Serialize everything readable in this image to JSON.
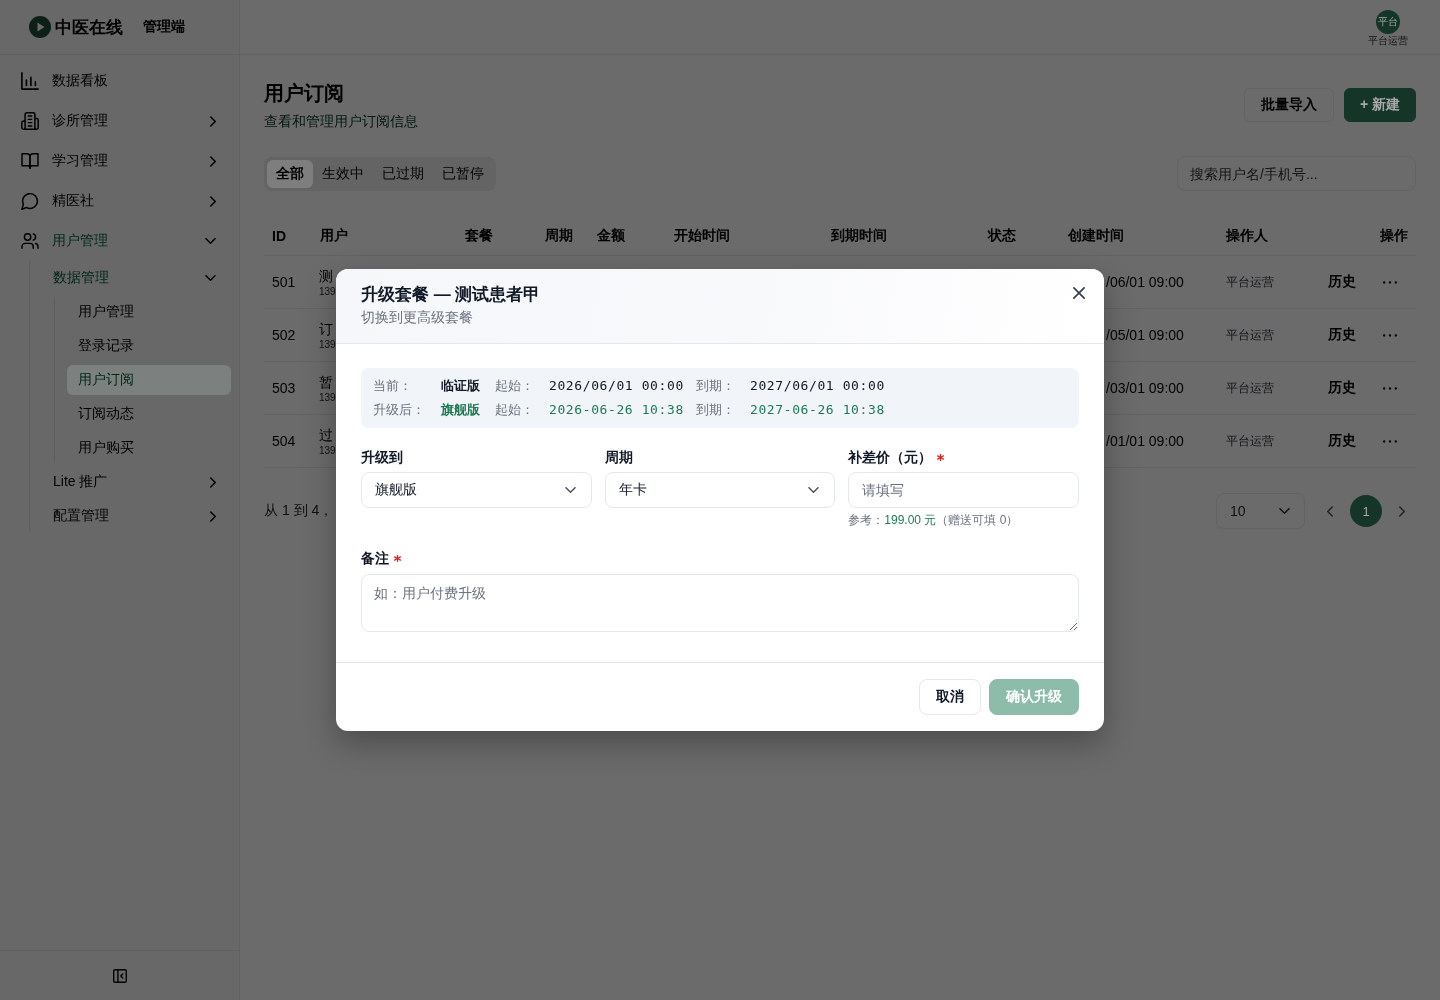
{
  "brand": {
    "name": "中医在线",
    "subtitle": "管理端"
  },
  "sidebar": {
    "items": [
      {
        "label": "数据看板",
        "selected": false
      },
      {
        "label": "诊所管理",
        "selected": false,
        "expanded": false
      },
      {
        "label": "学习管理",
        "selected": false,
        "expanded": false
      },
      {
        "label": "精医社",
        "selected": false,
        "expanded": false
      },
      {
        "label": "用户管理",
        "selected": false,
        "expanded": true,
        "children": [
          {
            "label": "数据管理",
            "selected": false,
            "expanded": true,
            "children": [
              {
                "label": "用户管理",
                "selected": false
              },
              {
                "label": "登录记录",
                "selected": false
              },
              {
                "label": "用户订阅",
                "selected": true
              },
              {
                "label": "订阅动态",
                "selected": false
              },
              {
                "label": "用户购买",
                "selected": false
              }
            ]
          },
          {
            "label": "Lite 推广",
            "selected": false,
            "expanded": false
          },
          {
            "label": "配置管理",
            "selected": false,
            "expanded": false
          }
        ]
      }
    ]
  },
  "user": {
    "avatar_text": "平台",
    "name": "平台运营"
  },
  "page": {
    "title": "用户订阅",
    "subtitle": "查看和管理用户订阅信息",
    "buttons": [
      {
        "label": "批量导入",
        "kind": "import"
      },
      {
        "label": "+ 新建",
        "kind": "create"
      }
    ]
  },
  "filter_tabs": [
    {
      "label": "全部",
      "selected": true
    },
    {
      "label": "生效中",
      "selected": false
    },
    {
      "label": "已过期",
      "selected": false
    },
    {
      "label": "已暂停",
      "selected": false
    }
  ],
  "search": {
    "placeholder": "搜索用户名/手机号..."
  },
  "table": {
    "columns": [
      "ID",
      "用户",
      "套餐",
      "周期",
      "金额",
      "开始时间",
      "到期时间",
      "状态",
      "创建时间",
      "操作人",
      "操作"
    ],
    "rows": [
      {
        "id": "501",
        "user": "测",
        "phone": "139",
        "created": "/06/01 09:00",
        "operator": "平台运营",
        "action": "历史"
      },
      {
        "id": "502",
        "user": "订",
        "phone": "139",
        "created": "/05/01 09:00",
        "operator": "平台运营",
        "action": "历史"
      },
      {
        "id": "503",
        "user": "暂",
        "phone": "139",
        "created": "/03/01 09:00",
        "operator": "平台运营",
        "action": "历史"
      },
      {
        "id": "504",
        "user": "过",
        "phone": "139",
        "created": "/01/01 09:00",
        "operator": "平台运营",
        "action": "历史"
      }
    ]
  },
  "pagination": {
    "summary": "从 1 到 4，",
    "page_size": "10",
    "pages": [
      {
        "label": "1",
        "selected": true
      }
    ]
  },
  "dialog": {
    "title": "升级套餐 — 测试患者甲",
    "subtitle": "切换到更高级套餐",
    "summary": [
      {
        "kind": "current",
        "label": "当前：",
        "plan": "临证版",
        "start_label": "起始：",
        "start": "2026/06/01 00:00",
        "end_label": "到期：",
        "end": "2027/06/01 00:00"
      },
      {
        "kind": "after",
        "label": "升级后：",
        "plan": "旗舰版",
        "start_label": "起始：",
        "start": "2026-06-26 10:38",
        "end_label": "到期：",
        "end": "2027-06-26 10:38"
      }
    ],
    "fields": [
      {
        "kind": "select",
        "label": "升级到",
        "value": "旗舰版",
        "required": false
      },
      {
        "kind": "select",
        "label": "周期",
        "value": "年卡",
        "required": false
      },
      {
        "kind": "input",
        "label": "补差价（元）",
        "placeholder": "请填写",
        "required": true,
        "hint": {
          "prefix": "参考：",
          "amount": "199.00 元",
          "suffix": "（赠送可填 0）"
        }
      }
    ],
    "note": {
      "label": "备注",
      "required": true,
      "placeholder": "如：用户付费升级"
    },
    "buttons": [
      {
        "label": "取消",
        "kind": "cancel",
        "disabled": false
      },
      {
        "label": "确认升级",
        "kind": "confirm",
        "disabled": true
      }
    ]
  }
}
